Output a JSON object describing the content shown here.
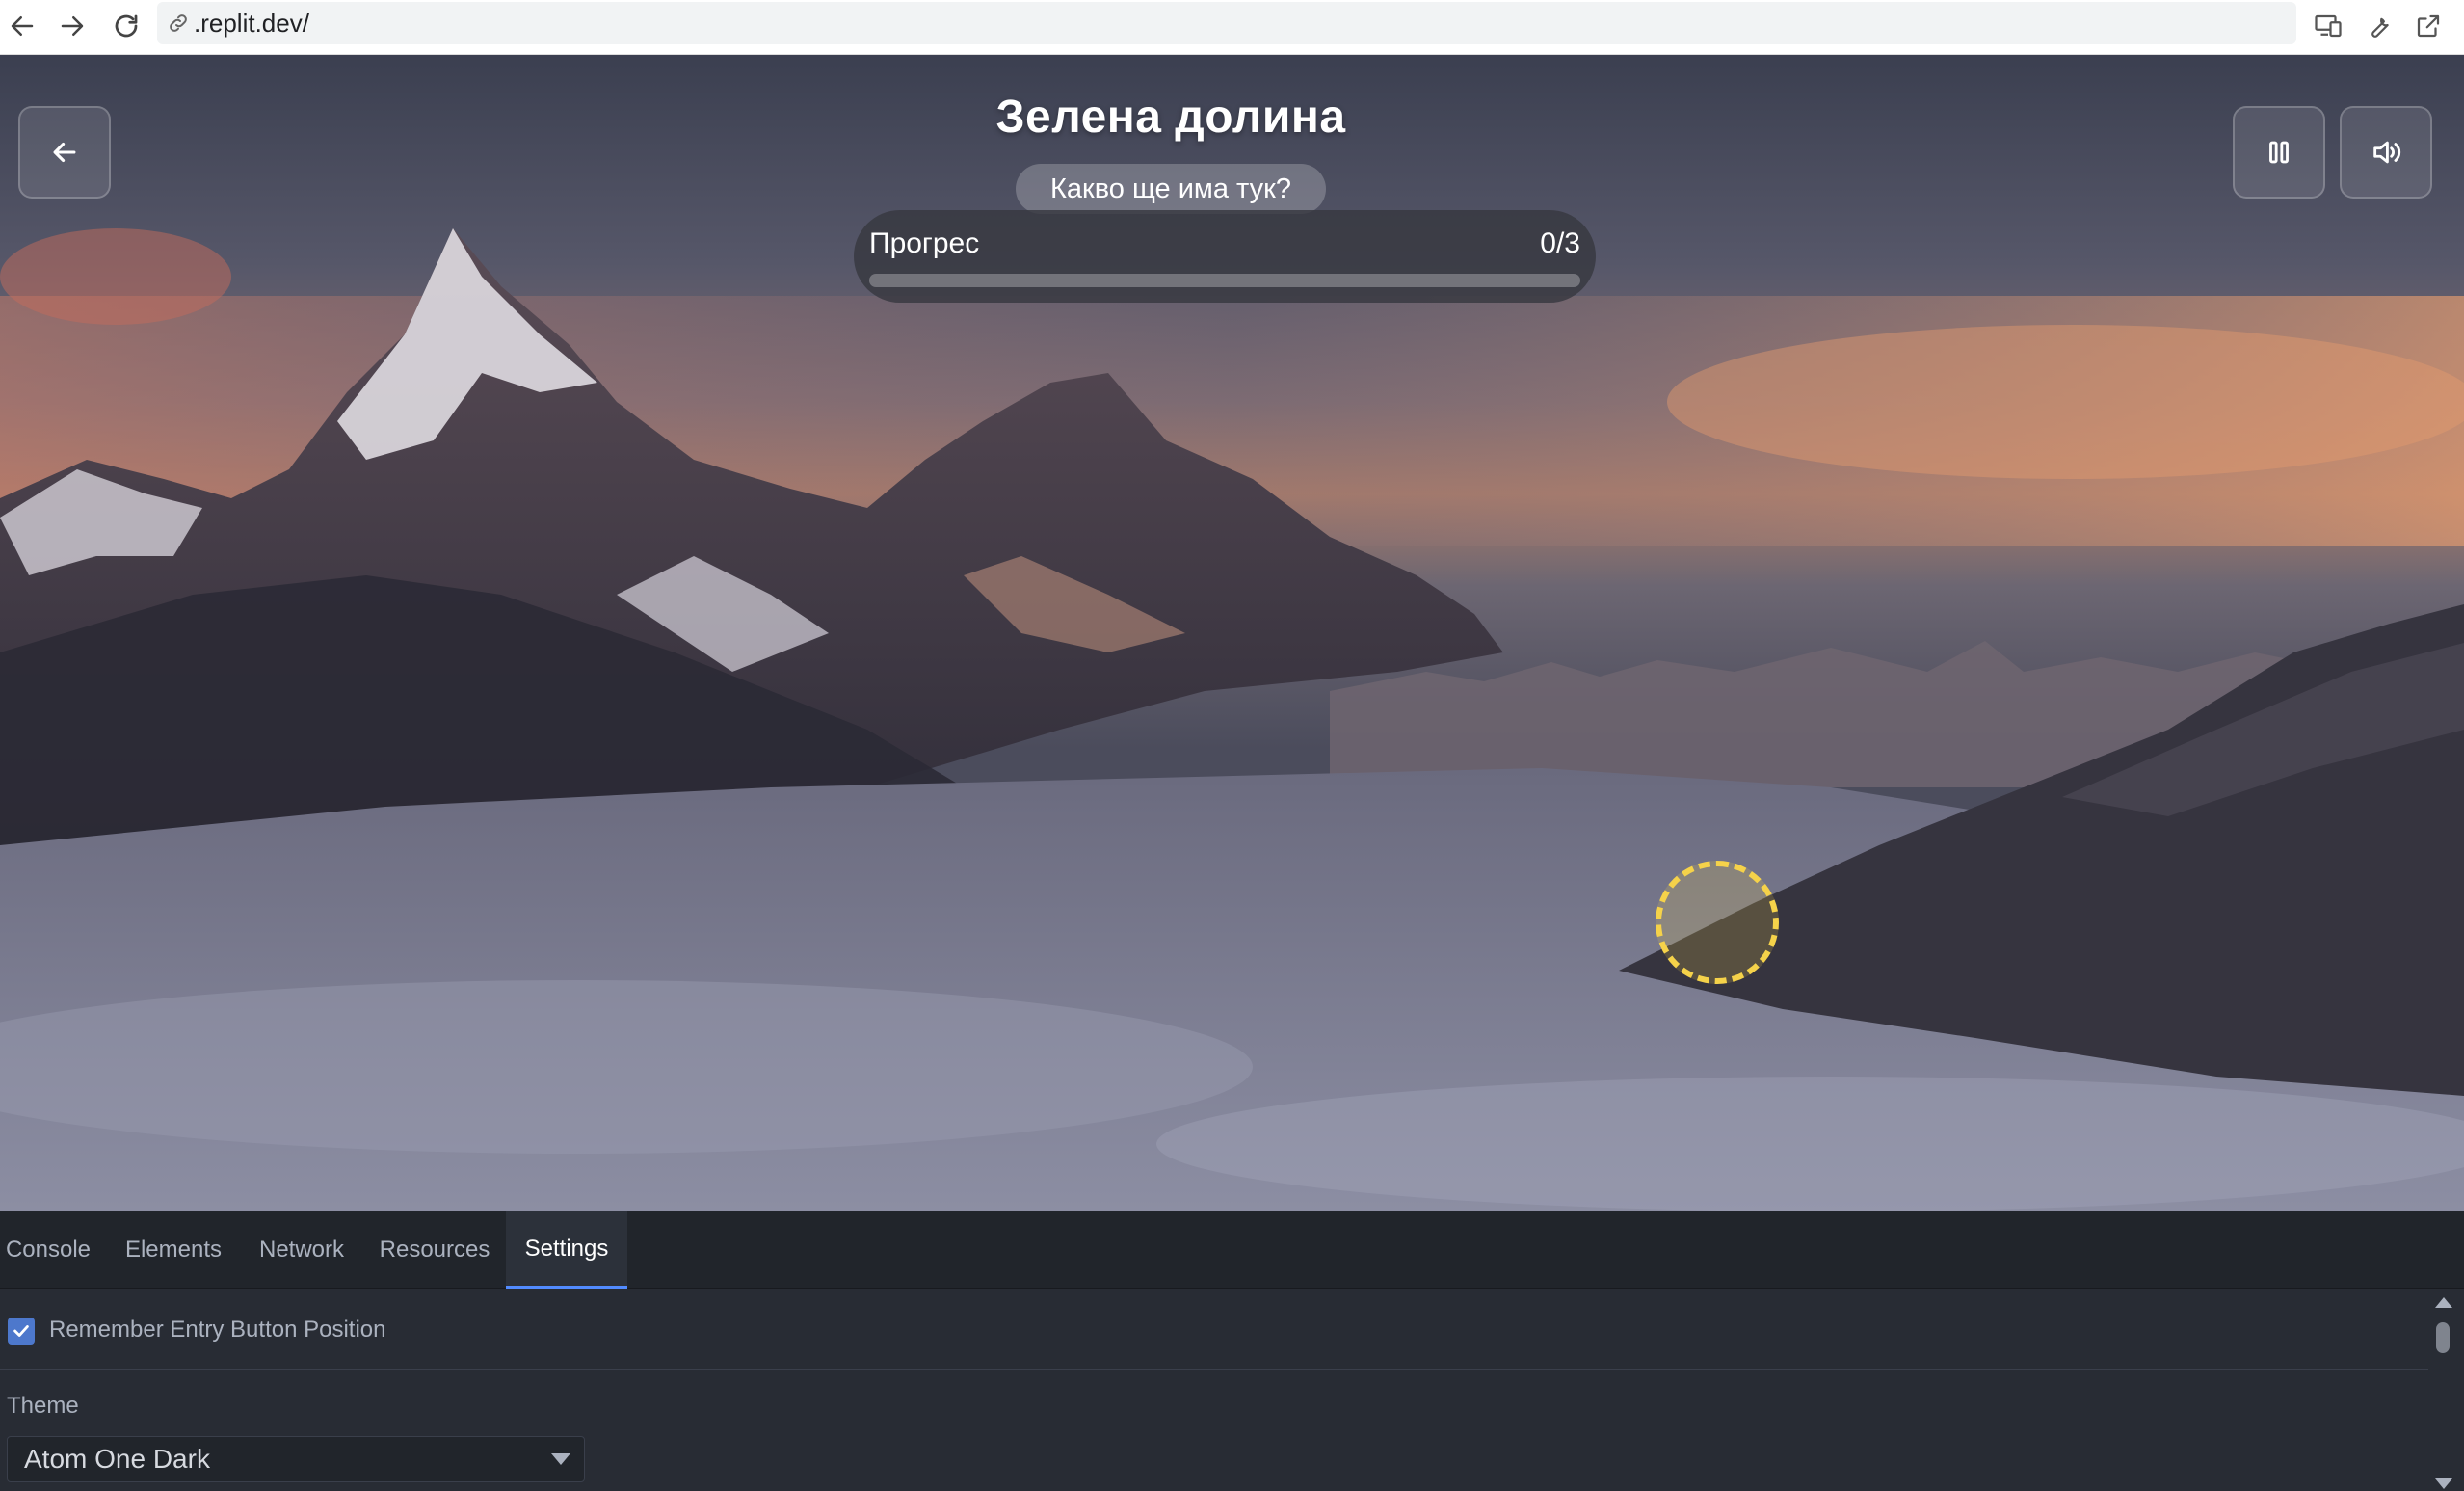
{
  "browser": {
    "url": ".replit.dev/",
    "toolbar_icons": [
      "back-icon",
      "forward-icon",
      "reload-icon",
      "link-icon",
      "device-toggle-icon",
      "wrench-icon",
      "open-external-icon"
    ]
  },
  "game": {
    "title": "Зелена долина",
    "hint": "Какво ще има тук?",
    "progress": {
      "label": "Прогрес",
      "count_text": "0/3",
      "found": 0,
      "total": 3,
      "fraction": 0
    },
    "buttons": {
      "back_icon": "arrow-left-icon",
      "pause_icon": "pause-icon",
      "sound_icon": "volume-icon"
    },
    "hotspot_color": "#f5d24a"
  },
  "devtools": {
    "tabs": [
      {
        "label": "Console",
        "active": false
      },
      {
        "label": "Elements",
        "active": false
      },
      {
        "label": "Network",
        "active": false
      },
      {
        "label": "Resources",
        "active": false
      },
      {
        "label": "Settings",
        "active": true
      }
    ],
    "settings": {
      "remember_label": "Remember Entry Button Position",
      "remember_checked": true,
      "theme_label": "Theme",
      "theme_value": "Atom One Dark"
    },
    "accent_color": "#528bff"
  }
}
